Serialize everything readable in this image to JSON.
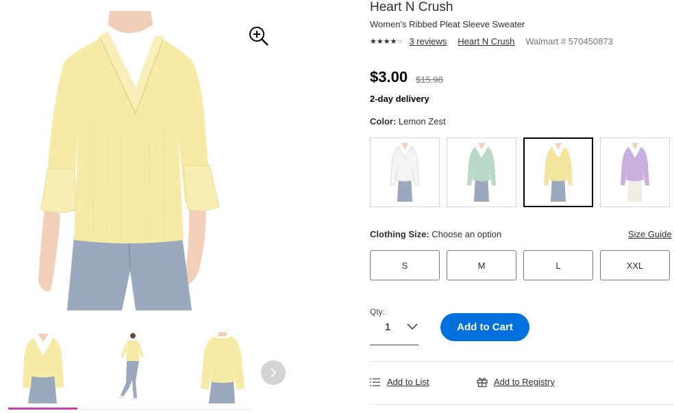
{
  "product": {
    "brand": "Heart N Crush",
    "title": "Women's Ribbed Pleat Sleeve Sweater",
    "rating": 4,
    "rating_max": 5,
    "reviews_link": "3 reviews",
    "brand_link": "Heart N Crush",
    "walmart_id": "Walmart # 570450873",
    "price": "$3.00",
    "was_price": "$15.98",
    "delivery": "2-day delivery"
  },
  "color": {
    "label": "Color:",
    "selected": "Lemon Zest",
    "swatches": [
      {
        "name": "white",
        "hex": "#f4f4f2",
        "selected": false
      },
      {
        "name": "mint",
        "hex": "#b9d8c8",
        "selected": false
      },
      {
        "name": "lemon zest",
        "hex": "#f3e59e",
        "selected": true
      },
      {
        "name": "lavender",
        "hex": "#c9aee0",
        "selected": false
      }
    ]
  },
  "size": {
    "label": "Clothing Size:",
    "prompt": "Choose an option",
    "guide_link": "Size Guide",
    "options": [
      "S",
      "M",
      "L",
      "XXL"
    ]
  },
  "quantity": {
    "label": "Qty:",
    "value": "1"
  },
  "cart": {
    "add_label": "Add to Cart"
  },
  "actions": {
    "add_to_list": "Add to List",
    "add_to_registry": "Add to Registry"
  },
  "colors": {
    "accent_blue": "#0071dc",
    "thumb_indicator": "#c53ea3",
    "sweater": "#f5eaa6",
    "jeans": "#9aa9bd"
  },
  "icons": {
    "zoom": "zoom-in-icon",
    "next": "chevron-right-icon",
    "qty": "chevron-down-icon",
    "list": "list-icon",
    "registry": "gift-icon"
  }
}
